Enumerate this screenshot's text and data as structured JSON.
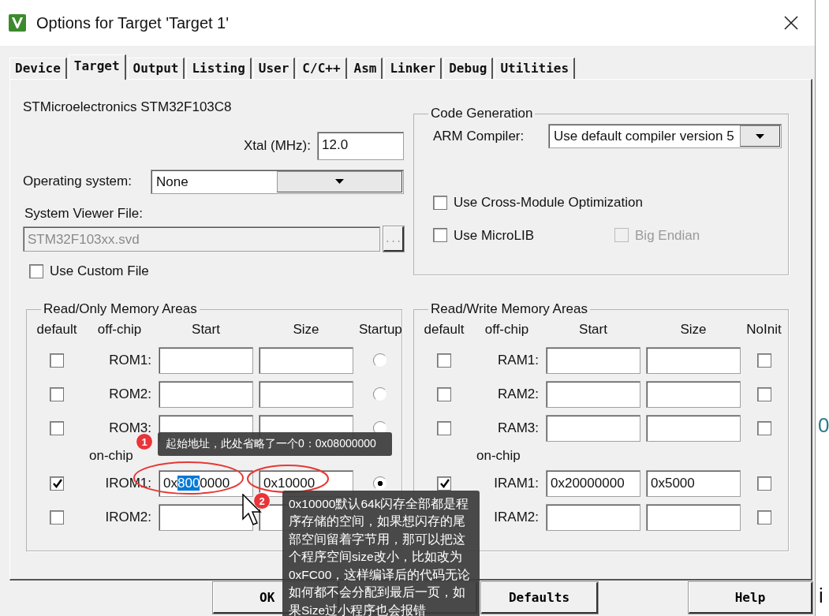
{
  "window": {
    "title": "Options for Target 'Target 1'"
  },
  "tabs": [
    {
      "label": "Device",
      "selected": false
    },
    {
      "label": "Target",
      "selected": true
    },
    {
      "label": "Output",
      "selected": false
    },
    {
      "label": "Listing",
      "selected": false
    },
    {
      "label": "User",
      "selected": false
    },
    {
      "label": "C/C++",
      "selected": false
    },
    {
      "label": "Asm",
      "selected": false
    },
    {
      "label": "Linker",
      "selected": false
    },
    {
      "label": "Debug",
      "selected": false
    },
    {
      "label": "Utilities",
      "selected": false
    }
  ],
  "device": "STMicroelectronics STM32F103C8",
  "xtal": {
    "label": "Xtal (MHz):",
    "value": "12.0"
  },
  "operating_system": {
    "label": "Operating system:",
    "value": "None"
  },
  "system_viewer_file": {
    "label": "System Viewer File:",
    "value": "STM32F103xx.svd",
    "disabled": true,
    "browse_label": "..."
  },
  "use_custom_file": {
    "label": "Use Custom File",
    "checked": false
  },
  "code_generation": {
    "title": "Code Generation",
    "compiler_label": "ARM Compiler:",
    "compiler_value": "Use default compiler version 5",
    "options": [
      {
        "label": "Use Cross-Module Optimization",
        "checked": false,
        "disabled": false
      },
      {
        "label": "Use MicroLIB",
        "checked": false,
        "disabled": false
      },
      {
        "label": "Big Endian",
        "checked": false,
        "disabled": true
      }
    ]
  },
  "read_only_memory": {
    "title": "Read/Only Memory Areas",
    "columns": [
      "default",
      "off-chip",
      "Start",
      "Size",
      "Startup"
    ],
    "on_chip_label": "on-chip",
    "off_chip_rows": [
      {
        "label": "ROM1:",
        "default": false,
        "startup": false
      },
      {
        "label": "ROM2:",
        "default": false,
        "startup": false
      },
      {
        "label": "ROM3:",
        "default": false,
        "startup": false
      }
    ],
    "on_chip_rows": [
      {
        "label": "IROM1:",
        "default": true,
        "start": [
          {
            "text": "0x",
            "selected": false
          },
          {
            "text": "800",
            "selected": true
          },
          {
            "text": "0000",
            "selected": false
          }
        ],
        "size": "0x10000",
        "startup": true
      },
      {
        "label": "IROM2:",
        "default": false
      }
    ]
  },
  "read_write_memory": {
    "title": "Read/Write Memory Areas",
    "columns": [
      "default",
      "off-chip",
      "Start",
      "Size",
      "NoInit"
    ],
    "on_chip_label": "on-chip",
    "off_chip_rows": [
      {
        "label": "RAM1:",
        "default": false,
        "noinit": false
      },
      {
        "label": "RAM2:",
        "default": false,
        "noinit": false
      },
      {
        "label": "RAM3:",
        "default": false,
        "noinit": false
      }
    ],
    "on_chip_rows": [
      {
        "label": "IRAM1:",
        "default": true,
        "start": "0x20000000",
        "size": "0x5000",
        "noinit": false
      },
      {
        "label": "IRAM2:",
        "noinit": false
      }
    ]
  },
  "buttons": [
    {
      "kind": "text",
      "label": "OK"
    },
    {
      "kind": "covered"
    },
    {
      "kind": "text",
      "label": "Defaults"
    },
    {
      "kind": "text",
      "label": "Help"
    }
  ],
  "annotations": [
    {
      "number": "1",
      "text": "起始地址，此处省略了一个0：0x08000000"
    },
    {
      "number": "2",
      "text": "0x10000默认64k闪存全部都是程序存储的空间，如果想闪存的尾部空间留着字节用，那可以把这个程序空间size改小，比如改为0xFC00，这样编译后的代码无论如何都不会分配到最后一页，如果Size过小程序也会报错"
    }
  ],
  "background_fragments": [
    "0",
    "i"
  ]
}
